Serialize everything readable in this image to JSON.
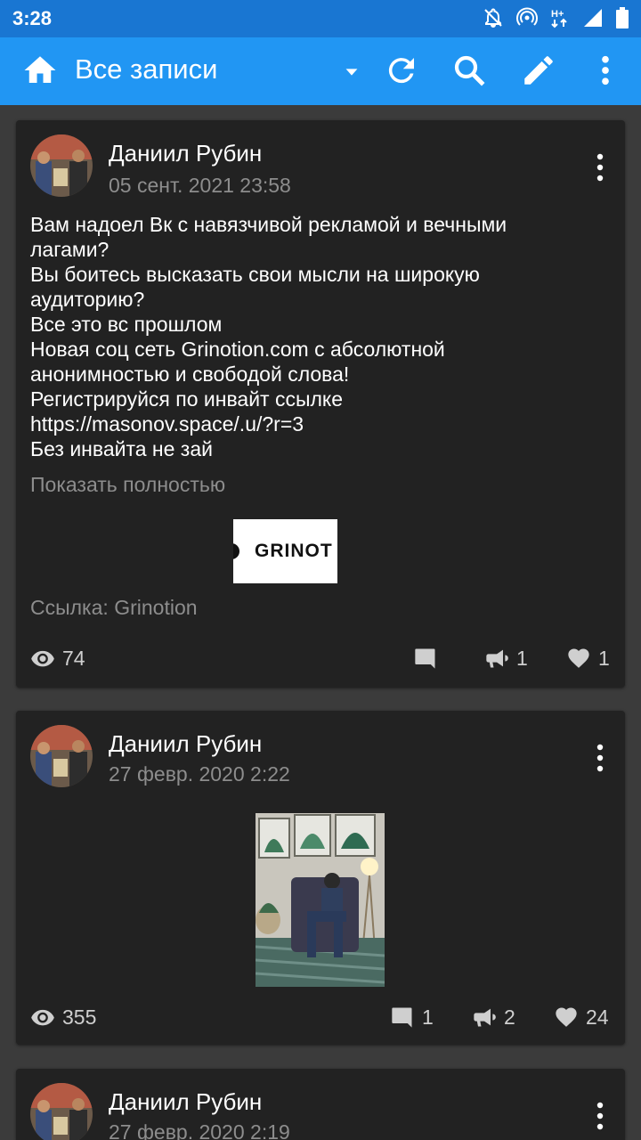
{
  "status_bar": {
    "time": "3:28",
    "icons": [
      "mute-icon",
      "hotspot-icon",
      "data-hplus-icon",
      "signal-icon",
      "battery-icon"
    ]
  },
  "app_bar": {
    "title": "Все записи",
    "icons": [
      "home-icon",
      "dropdown-arrow-icon",
      "refresh-icon",
      "search-icon",
      "edit-icon",
      "more-icon"
    ]
  },
  "posts": [
    {
      "author": "Даниил Рубин",
      "date": "05 сент. 2021 23:58",
      "text": "Вам надоел Вк с навязчивой рекламой и вечными\nлагами?\nВы боитесь высказать свои мысли на широкую\nаудиторию?\nВсе это вс прошлом\nНовая соц сеть Grinotion.com с абсолютной\nанонимностью и свободой слова!\nРегистрируйся по инвайт ссылке\nhttps://masonov.space/.u/?r=3\nБез инвайта не зай",
      "show_more": "Показать полностью",
      "logo_text": "GRINOT",
      "link_label": "Ссылка: Grinotion",
      "views": "74",
      "comments": "",
      "reposts": "1",
      "likes": "1"
    },
    {
      "author": "Даниил Рубин",
      "date": "27 февр. 2020 2:22",
      "views": "355",
      "comments": "1",
      "reposts": "2",
      "likes": "24"
    },
    {
      "author": "Даниил Рубин",
      "date": "27 февр. 2020 2:19"
    }
  ],
  "colors": {
    "status_bar": "#1976d2",
    "app_bar": "#2196f3",
    "background": "#3b3b3b",
    "card": "#222222",
    "muted_text": "#8d8d8d"
  }
}
